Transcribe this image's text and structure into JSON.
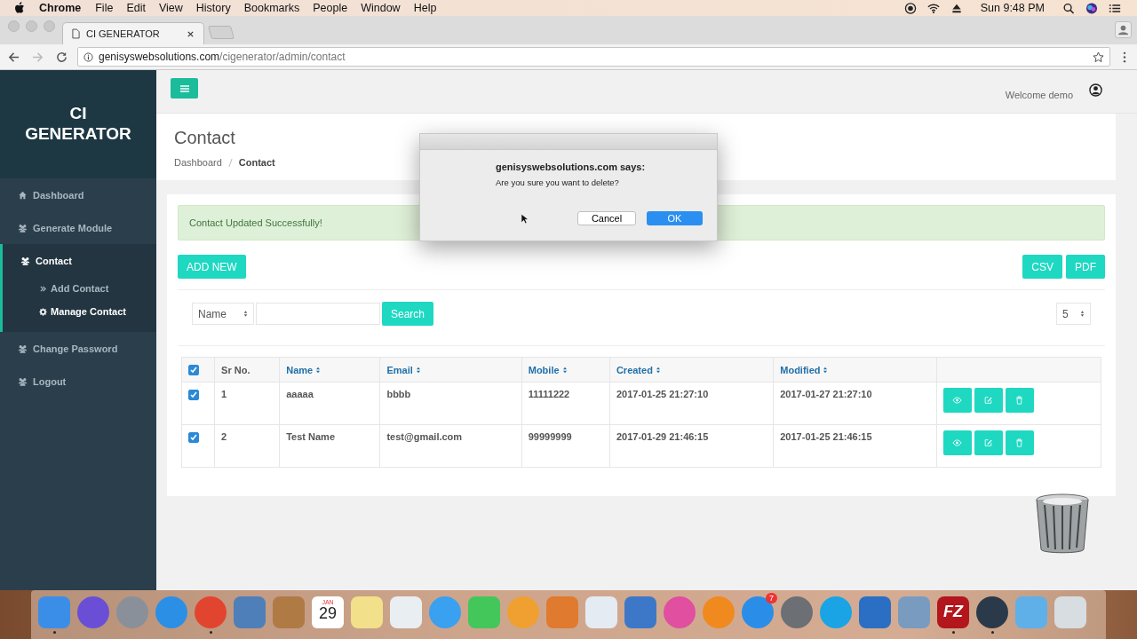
{
  "menu_bar": {
    "app": "Chrome",
    "items": [
      "File",
      "Edit",
      "View",
      "History",
      "Bookmarks",
      "People",
      "Window",
      "Help"
    ],
    "clock": "Sun 9:48 PM"
  },
  "browser": {
    "tab_title": "CI GENERATOR",
    "url_host": "genisyswebsolutions.com",
    "url_path": "/cigenerator/admin/contact"
  },
  "brand": "CI GENERATOR",
  "welcome": "Welcome demo",
  "sidebar": {
    "items": [
      {
        "label": "Dashboard",
        "kind": "home",
        "selected": false,
        "expanded": false
      },
      {
        "label": "Generate Module",
        "kind": "group",
        "selected": false,
        "expanded": false
      },
      {
        "label": "Contact",
        "kind": "group",
        "selected": true,
        "expanded": true,
        "children": [
          {
            "label": "Add Contact",
            "kind": "link",
            "selected": false
          },
          {
            "label": "Manage Contact",
            "kind": "settings",
            "selected": true
          }
        ]
      },
      {
        "label": "Change Password",
        "kind": "group",
        "selected": false,
        "expanded": false
      },
      {
        "label": "Logout",
        "kind": "group",
        "selected": false,
        "expanded": false
      }
    ]
  },
  "page": {
    "title": "Contact",
    "breadcrumb": [
      "Dashboard",
      "Contact"
    ]
  },
  "alert": "Contact Updated Successfully!",
  "buttons": {
    "add": "ADD NEW",
    "csv": "CSV",
    "pdf": "PDF",
    "search": "Search"
  },
  "filter": {
    "field": "Name",
    "page_size": "5"
  },
  "table": {
    "all_checked": true,
    "columns": [
      {
        "label": "Sr No.",
        "sortable": false
      },
      {
        "label": "Name",
        "sortable": true
      },
      {
        "label": "Email",
        "sortable": true
      },
      {
        "label": "Mobile",
        "sortable": true
      },
      {
        "label": "Created",
        "sortable": true
      },
      {
        "label": "Modified",
        "sortable": true
      }
    ],
    "rows": [
      {
        "checked": true,
        "cells": [
          "1",
          "aaaaa",
          "bbbb",
          "11111222",
          "2017-01-25 21:27:10",
          "2017-01-27 21:27:10"
        ]
      },
      {
        "checked": true,
        "cells": [
          "2",
          "Test Name",
          "test@gmail.com",
          "99999999",
          "2017-01-29 21:46:15",
          "2017-01-25 21:46:15"
        ]
      }
    ]
  },
  "dialog": {
    "title": "genisyswebsolutions.com says:",
    "message": "Are you sure you want to delete?",
    "cancel": "Cancel",
    "ok": "OK"
  },
  "dock": [
    {
      "kind": "square",
      "color": "#3b8ee8",
      "running": true
    },
    {
      "kind": "round",
      "color": "#6a4fd6",
      "running": false
    },
    {
      "kind": "round",
      "color": "#8a9099",
      "running": false
    },
    {
      "kind": "round",
      "color": "#2c8fe6",
      "running": false
    },
    {
      "kind": "round",
      "color": "#e2452f",
      "running": true
    },
    {
      "kind": "square",
      "color": "#4f7fb8",
      "running": false
    },
    {
      "kind": "square",
      "color": "#b07a45",
      "running": false
    },
    {
      "kind": "calendar",
      "month": "JAN",
      "day": "29",
      "running": false
    },
    {
      "kind": "square",
      "color": "#f3e08a",
      "running": false
    },
    {
      "kind": "square",
      "color": "#e9eef2",
      "running": false
    },
    {
      "kind": "round",
      "color": "#3aa0f0",
      "running": false
    },
    {
      "kind": "square",
      "color": "#43c75a",
      "running": false
    },
    {
      "kind": "round",
      "color": "#f0a030",
      "running": false
    },
    {
      "kind": "square",
      "color": "#e07a2e",
      "running": false
    },
    {
      "kind": "square",
      "color": "#e4ebf2",
      "running": false
    },
    {
      "kind": "square",
      "color": "#3d78c8",
      "running": false
    },
    {
      "kind": "round",
      "color": "#e04fa0",
      "running": false
    },
    {
      "kind": "round",
      "color": "#f08a1e",
      "running": false
    },
    {
      "kind": "round",
      "color": "#2a8de8",
      "running": false,
      "badge": "7"
    },
    {
      "kind": "round",
      "color": "#6c6f74",
      "running": false
    },
    {
      "kind": "round",
      "color": "#1aa4e6",
      "running": false
    },
    {
      "kind": "square",
      "color": "#2a6fc4",
      "running": false
    },
    {
      "kind": "square",
      "color": "#7a9bc0",
      "running": false
    },
    {
      "kind": "labeled",
      "color": "#b3161c",
      "label": "FZ",
      "running": true
    },
    {
      "kind": "round",
      "color": "#2b3a4a",
      "running": true
    },
    {
      "kind": "square",
      "color": "#5fb0e8",
      "running": false
    },
    {
      "kind": "square",
      "color": "#d8dde2",
      "running": false
    }
  ]
}
